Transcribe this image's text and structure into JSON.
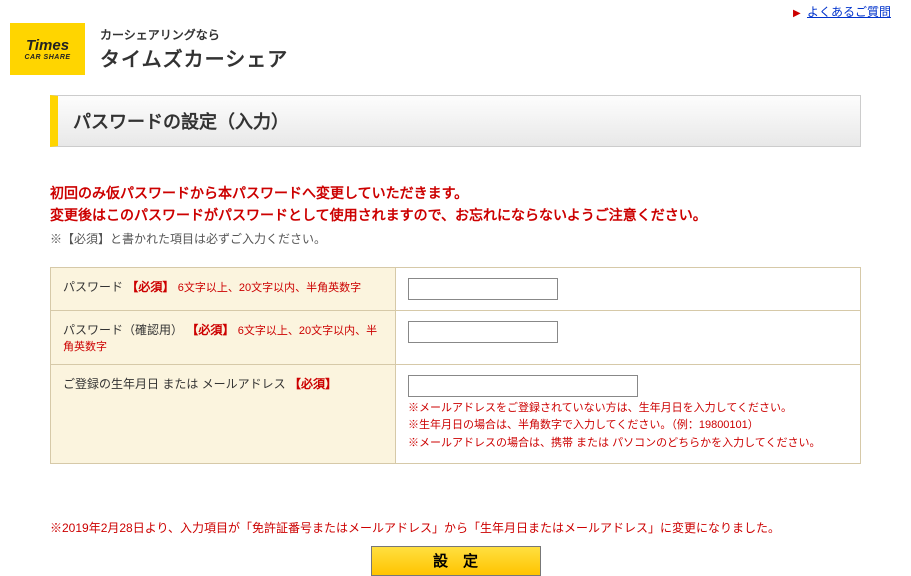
{
  "top_link": {
    "label": "よくあるご質問"
  },
  "logo": {
    "line1": "Times",
    "line2": "CAR SHARE"
  },
  "brand": {
    "tagline": "カーシェアリングなら",
    "name": "タイムズカーシェア"
  },
  "page_title": "パスワードの設定（入力）",
  "intro": {
    "line1": "初回のみ仮パスワードから本パスワードへ変更していただきます。",
    "line2": "変更後はこのパスワードがパスワードとして使用されますので、お忘れにならないようご注意ください。",
    "note": "※【必須】と書かれた項目は必ずご入力ください。"
  },
  "required_text": "【必須】",
  "fields": {
    "password": {
      "label": "パスワード",
      "hint": "6文字以上、20文字以内、半角英数字",
      "value": ""
    },
    "password_confirm": {
      "label": "パスワード（確認用）",
      "hint": "6文字以上、20文字以内、半角英数字",
      "value": ""
    },
    "birth_or_email": {
      "label": "ご登録の生年月日 または メールアドレス",
      "value": "",
      "notes": {
        "n1": "※メールアドレスをご登録されていない方は、生年月日を入力してください。",
        "n2": "※生年月日の場合は、半角数字で入力してください。（例：19800101）",
        "n3": "※メールアドレスの場合は、携帯 または パソコンのどちらかを入力してください。"
      }
    }
  },
  "change_notice": "※2019年2月28日より、入力項目が「免許証番号またはメールアドレス」から「生年月日またはメールアドレス」に変更になりました。",
  "submit_label": "設定"
}
